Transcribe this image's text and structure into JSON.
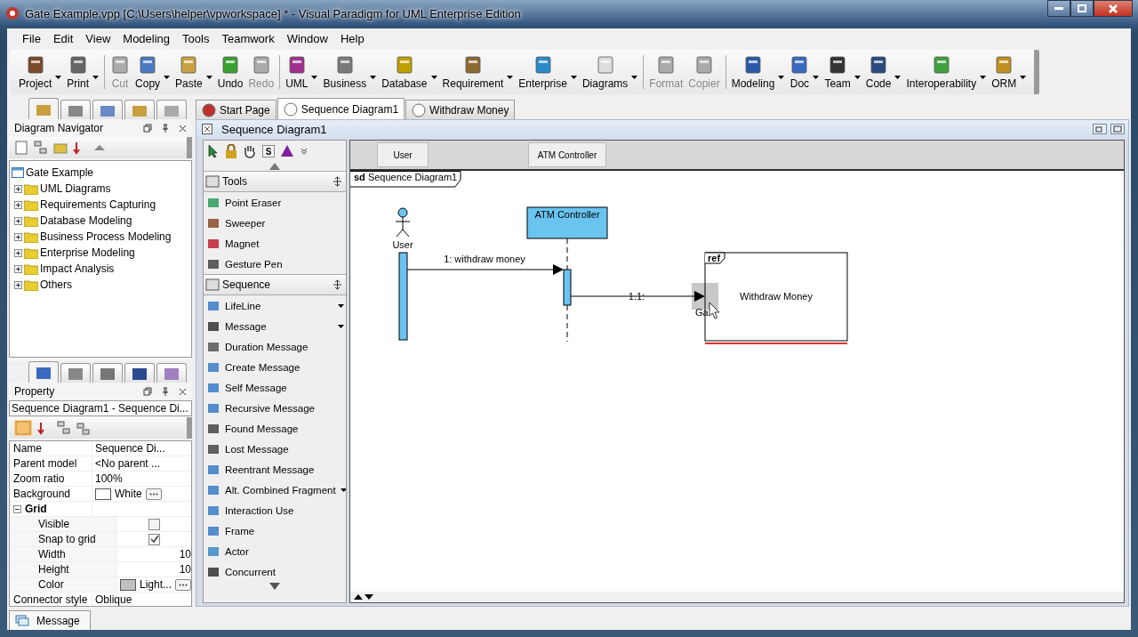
{
  "window": {
    "title": "Gate Example.vpp [C:\\Users\\helper\\vpworkspace] * - Visual Paradigm for UML Enterprise Edition"
  },
  "menu": [
    "File",
    "Edit",
    "View",
    "Modeling",
    "Tools",
    "Teamwork",
    "Window",
    "Help"
  ],
  "toolbar_groups": [
    [
      {
        "label": "Project",
        "disabled": false,
        "dropdown": true
      },
      {
        "label": "Print",
        "disabled": false,
        "dropdown": true
      }
    ],
    [
      {
        "label": "Cut",
        "disabled": true,
        "dropdown": false
      },
      {
        "label": "Copy",
        "disabled": false,
        "dropdown": true
      },
      {
        "label": "Paste",
        "disabled": false,
        "dropdown": true
      },
      {
        "label": "Undo",
        "disabled": false,
        "dropdown": false
      },
      {
        "label": "Redo",
        "disabled": true,
        "dropdown": false
      }
    ],
    [
      {
        "label": "UML",
        "disabled": false,
        "dropdown": true
      },
      {
        "label": "Business",
        "disabled": false,
        "dropdown": true
      },
      {
        "label": "Database",
        "disabled": false,
        "dropdown": true
      },
      {
        "label": "Requirement",
        "disabled": false,
        "dropdown": true
      },
      {
        "label": "Enterprise",
        "disabled": false,
        "dropdown": true
      },
      {
        "label": "Diagrams",
        "disabled": false,
        "dropdown": true
      }
    ],
    [
      {
        "label": "Format",
        "disabled": true,
        "dropdown": false
      },
      {
        "label": "Copier",
        "disabled": true,
        "dropdown": false
      }
    ],
    [
      {
        "label": "Modeling",
        "disabled": false,
        "dropdown": true
      },
      {
        "label": "Doc",
        "disabled": false,
        "dropdown": true
      },
      {
        "label": "Team",
        "disabled": false,
        "dropdown": true
      },
      {
        "label": "Code",
        "disabled": false,
        "dropdown": true
      },
      {
        "label": "Interoperability",
        "disabled": false,
        "dropdown": true
      },
      {
        "label": "ORM",
        "disabled": false,
        "dropdown": true
      }
    ]
  ],
  "navigator": {
    "title": "Diagram Navigator",
    "root": {
      "label": "Gate Example",
      "children": [
        {
          "label": "UML Diagrams",
          "expanded": false
        },
        {
          "label": "Requirements Capturing",
          "expanded": false
        },
        {
          "label": "Database Modeling",
          "expanded": false
        },
        {
          "label": "Business Process Modeling",
          "expanded": false
        },
        {
          "label": "Enterprise Modeling",
          "expanded": false
        },
        {
          "label": "Impact Analysis",
          "expanded": false
        },
        {
          "label": "Others",
          "expanded": false
        }
      ]
    }
  },
  "property": {
    "title": "Property",
    "selector": "Sequence Diagram1 - Sequence Di...",
    "rows": [
      {
        "kind": "text",
        "name": "Name",
        "value": "Sequence Di..."
      },
      {
        "kind": "text",
        "name": "Parent model",
        "value": "<No parent ..."
      },
      {
        "kind": "text",
        "name": "Zoom ratio",
        "value": "100%"
      },
      {
        "kind": "color",
        "name": "Background",
        "value": "White",
        "color": "#ffffff"
      },
      {
        "kind": "group",
        "name": "Grid",
        "expanded": true,
        "children": [
          {
            "kind": "check",
            "name": "Visible",
            "checked": false
          },
          {
            "kind": "check",
            "name": "Snap to grid",
            "checked": true
          },
          {
            "kind": "number",
            "name": "Width",
            "value": "10"
          },
          {
            "kind": "number",
            "name": "Height",
            "value": "10"
          },
          {
            "kind": "color",
            "name": "Color",
            "value": "Light...",
            "color": "#c0c0c0"
          }
        ]
      },
      {
        "kind": "text",
        "name": "Connector style",
        "value": "Oblique"
      }
    ]
  },
  "editor_tabs": [
    {
      "label": "Start Page",
      "selected": false
    },
    {
      "label": "Sequence Diagram1",
      "selected": true
    },
    {
      "label": "Withdraw Money",
      "selected": false
    }
  ],
  "diagram_title": "Sequence Diagram1",
  "palette_mode_label": "S",
  "palette": [
    {
      "title": "Tools",
      "items": [
        {
          "label": "Point Eraser",
          "dropdown": false
        },
        {
          "label": "Sweeper",
          "dropdown": false
        },
        {
          "label": "Magnet",
          "dropdown": false
        },
        {
          "label": "Gesture Pen",
          "dropdown": false
        }
      ]
    },
    {
      "title": "Sequence",
      "items": [
        {
          "label": "LifeLine",
          "dropdown": true
        },
        {
          "label": "Message",
          "dropdown": true
        },
        {
          "label": "Duration Message",
          "dropdown": false
        },
        {
          "label": "Create Message",
          "dropdown": false
        },
        {
          "label": "Self Message",
          "dropdown": false
        },
        {
          "label": "Recursive Message",
          "dropdown": false
        },
        {
          "label": "Found Message",
          "dropdown": false
        },
        {
          "label": "Lost Message",
          "dropdown": false
        },
        {
          "label": "Reentrant Message",
          "dropdown": false
        },
        {
          "label": "Alt. Combined Fragment",
          "dropdown": true
        },
        {
          "label": "Interaction Use",
          "dropdown": false
        },
        {
          "label": "Frame",
          "dropdown": false
        },
        {
          "label": "Actor",
          "dropdown": false
        },
        {
          "label": "Concurrent",
          "dropdown": false
        }
      ]
    }
  ],
  "lifeline_headers": [
    "User",
    "ATM Controller"
  ],
  "diagram": {
    "frame_label": "**sd** Sequence Diagram1",
    "actor": "User",
    "lifeline": "ATM Controller",
    "message_1": "1: withdraw money",
    "message_2": "1.1:",
    "ref_tag": "ref",
    "ref_label": "Withdraw Money",
    "gate": "Ga"
  },
  "status_tabs": [
    "Message"
  ]
}
